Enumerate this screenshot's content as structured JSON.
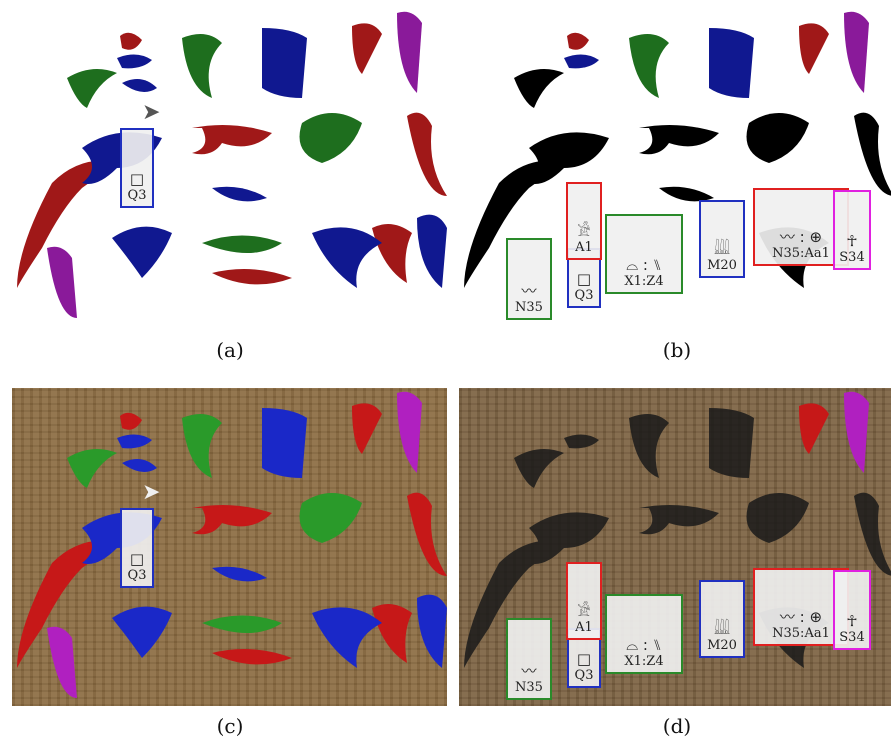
{
  "captions": {
    "a": "(a)",
    "b": "(b)",
    "c": "(c)",
    "d": "(d)"
  },
  "colors": {
    "red": "#a01818",
    "blue": "#101890",
    "green": "#1e6e1e",
    "purple": "#8a1a9a",
    "black": "#000000",
    "papyrus": "#8a6a40",
    "box_red": "#e02020",
    "box_blue": "#2030c0",
    "box_green": "#2a8a2a",
    "box_magenta": "#e020e0"
  },
  "labels": {
    "q3": "Q3",
    "a1": "A1",
    "n35": "N35",
    "x1z4": "X1:Z4",
    "m20": "M20",
    "n35aa1": "N35:Aa1",
    "s34": "S34"
  },
  "glyphs": {
    "q3": "□",
    "a1": "𓀀",
    "n35": "〰",
    "x1z4": "⌓ : ⑊",
    "m20": "𓇏",
    "n35aa1": "〰 : ⊕",
    "s34": "☥"
  },
  "icons": {
    "cursor": "mouse-pointer-icon"
  }
}
